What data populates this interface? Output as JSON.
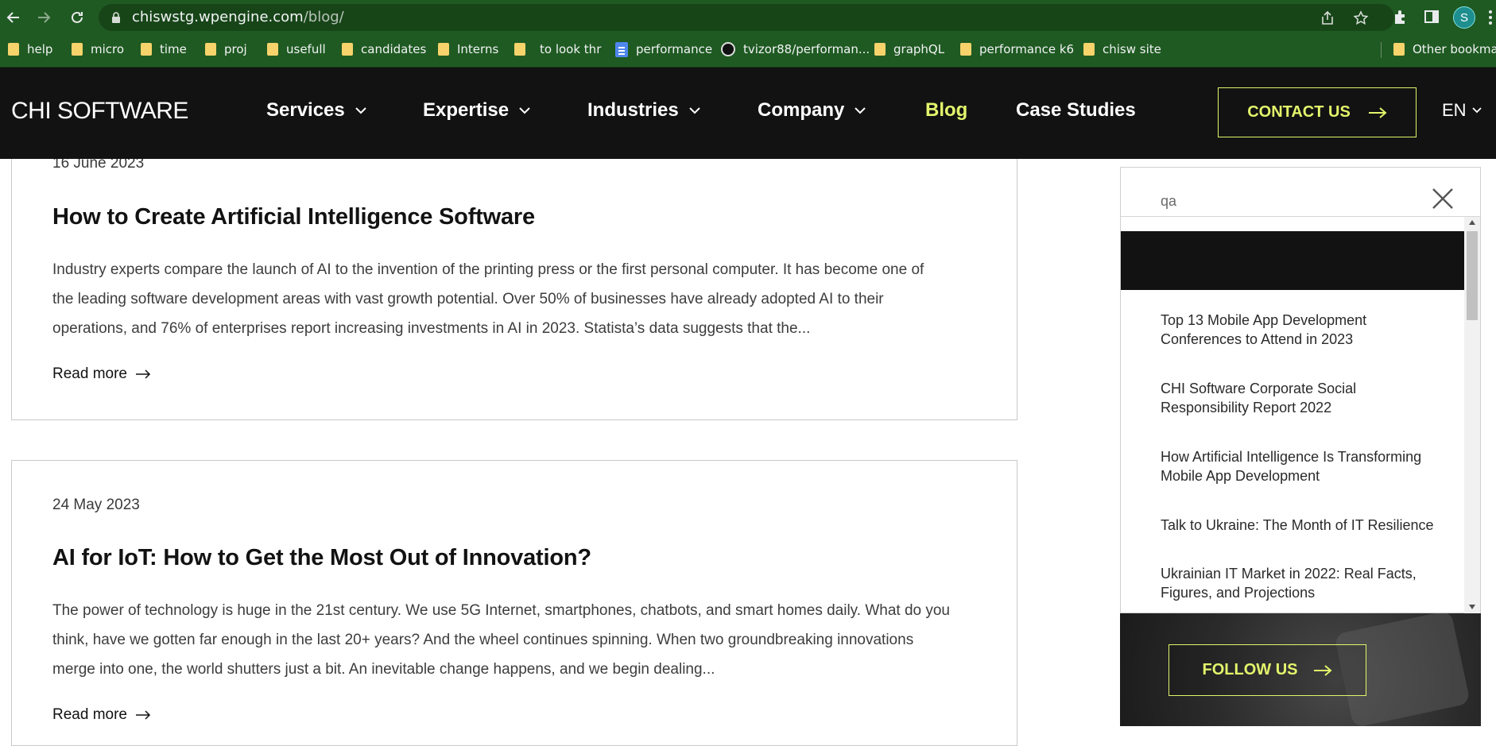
{
  "browser": {
    "url_host": "chiswstg.wpengine.com",
    "url_path": "/blog/",
    "profile_initial": "S",
    "bookmarks": [
      {
        "label": "help",
        "icon": "folder-icon"
      },
      {
        "label": "micro",
        "icon": "folder-icon"
      },
      {
        "label": "time",
        "icon": "folder-icon"
      },
      {
        "label": "proj",
        "icon": "folder-icon"
      },
      {
        "label": "usefull",
        "icon": "folder-icon"
      },
      {
        "label": "candidates",
        "icon": "folder-icon"
      },
      {
        "label": "Interns",
        "icon": "folder-icon"
      },
      {
        "label": "to look thr",
        "icon": "folder-icon"
      },
      {
        "label": "performance",
        "icon": "google-docs-icon"
      },
      {
        "label": "tvizor88/performan...",
        "icon": "github-icon"
      },
      {
        "label": "graphQL",
        "icon": "folder-icon"
      },
      {
        "label": "performance k6",
        "icon": "folder-icon"
      },
      {
        "label": "chisw site",
        "icon": "folder-icon"
      }
    ],
    "other_bookmarks": "Other bookmarks"
  },
  "header": {
    "logo": "CHI SOFTWARE",
    "menu": [
      {
        "label": "Services",
        "dropdown": true
      },
      {
        "label": "Expertise",
        "dropdown": true
      },
      {
        "label": "Industries",
        "dropdown": true
      },
      {
        "label": "Company",
        "dropdown": true
      },
      {
        "label": "Blog",
        "dropdown": false,
        "active": true
      },
      {
        "label": "Case Studies",
        "dropdown": false
      }
    ],
    "contact_label": "CONTACT US",
    "language": "EN",
    "accent_color": "#e3f56b",
    "background_color": "#121212"
  },
  "posts": [
    {
      "date": "16 June 2023",
      "title": "How to Create Artificial Intelligence Software",
      "excerpt_lines": [
        "Industry experts compare the launch of AI to the invention of the printing press or the first personal computer. It has become one of",
        "the leading software development areas with vast growth potential.  Over 50% of businesses have already adopted AI to their",
        "operations, and 76% of enterprises report increasing investments in AI in 2023. Statista’s data  suggests that the..."
      ],
      "read_more": "Read more"
    },
    {
      "date": "24 May 2023",
      "title": "AI for IoT: How to Get the Most Out of Innovation?",
      "excerpt_lines": [
        "The power of technology is huge in the 21st century. We use 5G Internet, smartphones, chatbots, and smart homes daily. What do you",
        "think, have we gotten far enough in the last 20+ years? And the wheel continues spinning.  When two groundbreaking innovations",
        "merge into one, the world shutters just a bit. An inevitable change happens, and we begin dealing..."
      ],
      "read_more": "Read more"
    }
  ],
  "search": {
    "query": "qa",
    "results": [
      {
        "line1": "Top 13 Mobile App Development",
        "line2": "Conferences to Attend in 2023"
      },
      {
        "line1": "CHI Software Corporate Social",
        "line2": "Responsibility Report 2022"
      },
      {
        "line1": "How Artificial Intelligence Is Transforming",
        "line2": "Mobile App Development"
      },
      {
        "line1": "Talk to Ukraine: The Month of IT Resilience",
        "line2": ""
      },
      {
        "line1": "Ukrainian IT Market in 2022: Real Facts,",
        "line2": "Figures, and Projections"
      }
    ]
  },
  "sidebar": {
    "follow_label": "FOLLOW US"
  }
}
